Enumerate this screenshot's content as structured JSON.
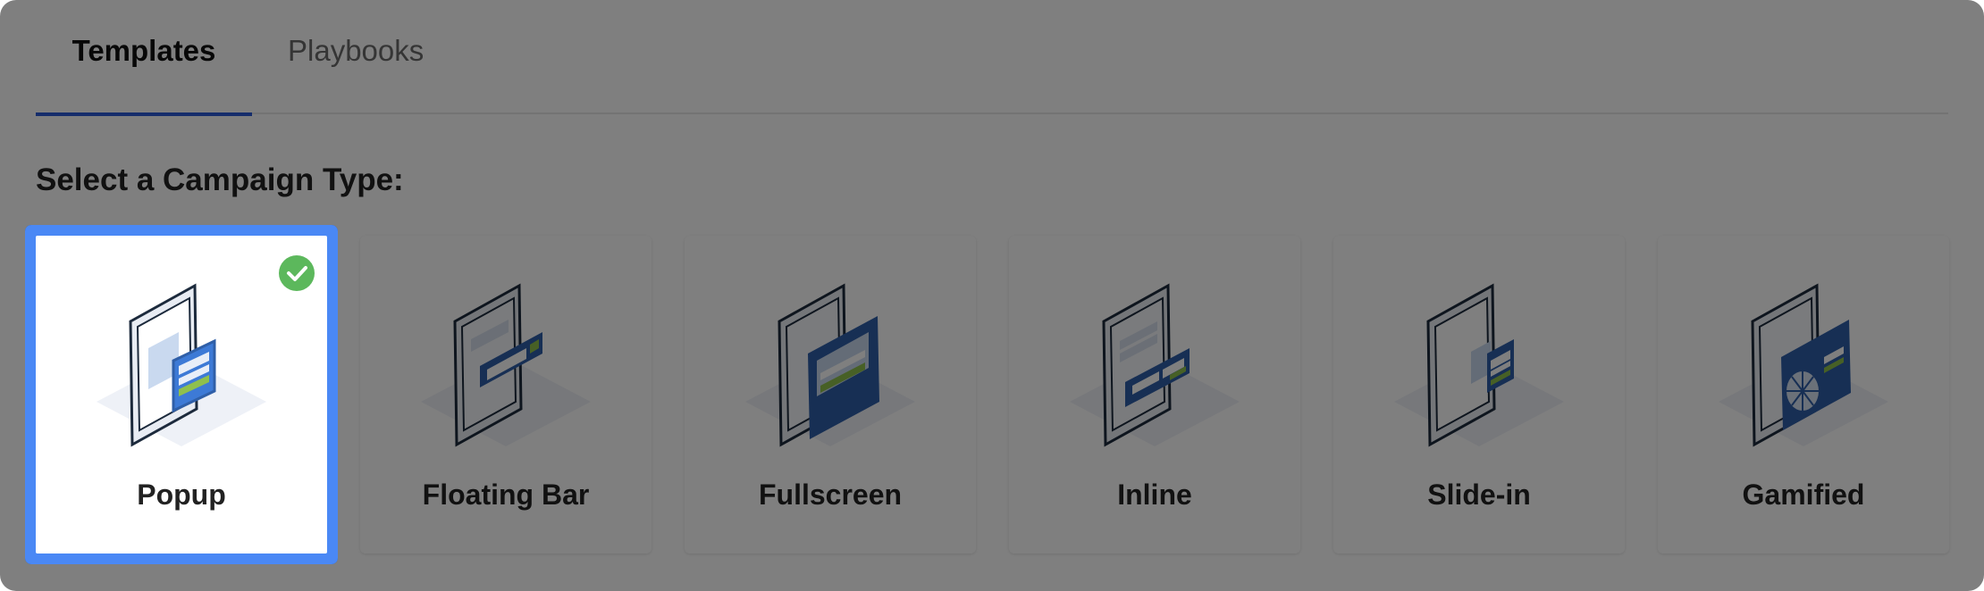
{
  "tabs": [
    {
      "label": "Templates",
      "active": true
    },
    {
      "label": "Playbooks",
      "active": false
    }
  ],
  "section_title": "Select a Campaign Type:",
  "campaign_types": [
    {
      "label": "Popup",
      "selected": true,
      "icon": "popup-illustration"
    },
    {
      "label": "Floating Bar",
      "selected": false,
      "icon": "floating-bar-illustration"
    },
    {
      "label": "Fullscreen",
      "selected": false,
      "icon": "fullscreen-illustration"
    },
    {
      "label": "Inline",
      "selected": false,
      "icon": "inline-illustration"
    },
    {
      "label": "Slide-in",
      "selected": false,
      "icon": "slide-in-illustration"
    },
    {
      "label": "Gamified",
      "selected": false,
      "icon": "gamified-illustration"
    }
  ],
  "colors": {
    "accent": "#4a88f5",
    "tab_underline": "#2a5bd7",
    "check": "#5cb85c",
    "illustration_blue": "#2f5fa8",
    "illustration_green": "#6aa84f",
    "overlay": "rgba(0,0,0,0.5)"
  }
}
